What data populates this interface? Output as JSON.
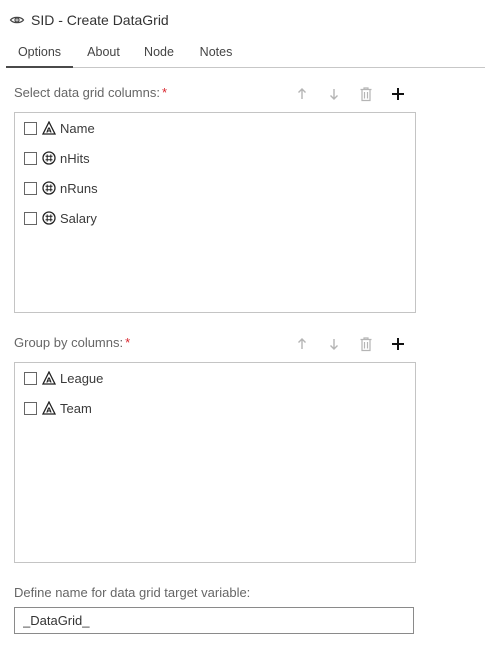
{
  "window": {
    "title": "SID - Create DataGrid",
    "icon": "eye-gear-icon"
  },
  "tabs": [
    {
      "label": "Options",
      "active": true
    },
    {
      "label": "About",
      "active": false
    },
    {
      "label": "Node",
      "active": false
    },
    {
      "label": "Notes",
      "active": false
    }
  ],
  "data_columns": {
    "label": "Select data grid columns:",
    "required_marker": "*",
    "toolbar": [
      "arrow-up-icon",
      "arrow-down-icon",
      "trash-icon",
      "plus-icon"
    ],
    "items": [
      {
        "label": "Name",
        "type_icon": "character-column-icon"
      },
      {
        "label": "nHits",
        "type_icon": "numeric-column-icon"
      },
      {
        "label": "nRuns",
        "type_icon": "numeric-column-icon"
      },
      {
        "label": "Salary",
        "type_icon": "numeric-column-icon"
      }
    ]
  },
  "group_columns": {
    "label": "Group by columns:",
    "required_marker": "*",
    "toolbar": [
      "arrow-up-icon",
      "arrow-down-icon",
      "trash-icon",
      "plus-icon"
    ],
    "items": [
      {
        "label": "League",
        "type_icon": "character-column-icon"
      },
      {
        "label": "Team",
        "type_icon": "character-column-icon"
      }
    ]
  },
  "target_variable": {
    "label": "Define name for data grid target variable:",
    "value": "_DataGrid_"
  },
  "colors": {
    "required": "#d9262e",
    "border": "#c4c4c4",
    "text": "#3a3a3a",
    "disabled_icon": "#b5b5b5"
  }
}
